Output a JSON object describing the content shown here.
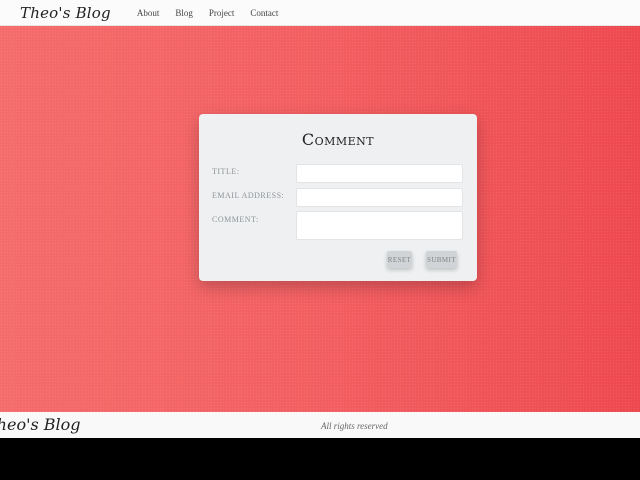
{
  "navbar": {
    "brand": "Theo's Blog",
    "links": [
      {
        "label": "About"
      },
      {
        "label": "Blog"
      },
      {
        "label": "Project"
      },
      {
        "label": "Contact"
      }
    ]
  },
  "comment_form": {
    "title": "Comment",
    "fields": {
      "title": {
        "label": "Title:",
        "value": "",
        "placeholder": ""
      },
      "email": {
        "label": "Email address:",
        "value": "",
        "placeholder": ""
      },
      "comment": {
        "label": "Comment:",
        "value": "",
        "placeholder": ""
      }
    },
    "buttons": {
      "reset": "Reset",
      "submit": "Submit"
    }
  },
  "footer": {
    "brand": "Theo's Blog",
    "rights": "All rights reserved"
  },
  "colors": {
    "hero_gradient_start": "#f56c6c",
    "hero_gradient_end": "#ed4a50",
    "card_background": "#eef0f1",
    "button_background": "#d1d4d6",
    "navbar_background": "#fbfbfb"
  }
}
